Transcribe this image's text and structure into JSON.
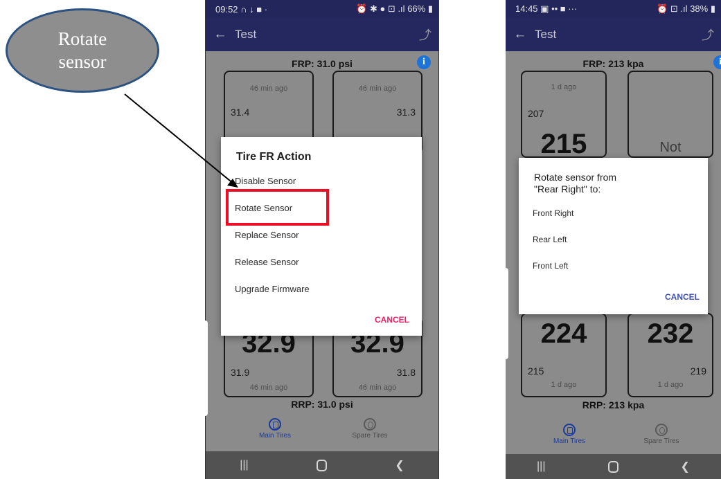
{
  "callout": {
    "line1": "Rotate",
    "line2": "sensor"
  },
  "phone1": {
    "status_time": "09:52",
    "status_left_icons": "∩ ↓ ■ ·",
    "status_right_icons": "⏰ ✱ ● ⊡ .ıl",
    "battery": "66%",
    "title": "Test",
    "front_pressure": "FRP: 31.0 psi",
    "rear_pressure": "RRP: 31.0 psi",
    "tires": {
      "front_left": {
        "ago": "46 min ago",
        "value": "31.4"
      },
      "front_right": {
        "ago": "46 min ago",
        "value": "31.3"
      },
      "rear_left": {
        "ago": "46 min ago",
        "value": "31.9",
        "big": "32.9"
      },
      "rear_right": {
        "ago": "46 min ago",
        "value": "31.8",
        "big": "32.9"
      }
    },
    "dialog": {
      "title": "Tire FR Action",
      "items": [
        "Disable Sensor",
        "Rotate Sensor",
        "Replace Sensor",
        "Release Sensor",
        "Upgrade Firmware"
      ],
      "cancel": "CANCEL"
    },
    "nav": {
      "main": "Main Tires",
      "spare": "Spare Tires"
    }
  },
  "phone2": {
    "status_time": "14:45",
    "status_left_icons": "▣ •• ■ ···",
    "status_right_icons": "⏰ ⊡ .ıl",
    "battery": "38%",
    "title": "Test",
    "front_pressure": "FRP: 213 kpa",
    "rear_pressure": "RRP: 213 kpa",
    "tires": {
      "front_left": {
        "ago": "1 d ago",
        "value": "207",
        "big": "215"
      },
      "front_right": {
        "status": "Not"
      },
      "rear_left": {
        "ago": "1 d ago",
        "value": "215",
        "big": "224"
      },
      "rear_right": {
        "ago": "1 d ago",
        "value": "219",
        "big": "232"
      }
    },
    "dialog": {
      "title_line1": "Rotate sensor from",
      "title_line2": "\"Rear Right\" to:",
      "items": [
        "Front Right",
        "Rear Left",
        "Front Left"
      ],
      "cancel": "CANCEL"
    },
    "nav": {
      "main": "Main Tires",
      "spare": "Spare Tires"
    }
  },
  "colors": {
    "appbar": "#24285e",
    "highlight": "#ea0f24",
    "callout_fill": "#8e8e8e",
    "callout_border": "#2c5282",
    "cancel_pink": "#e91e63",
    "cancel_blue": "#3f51b5",
    "info_blue": "#1e73d8"
  }
}
